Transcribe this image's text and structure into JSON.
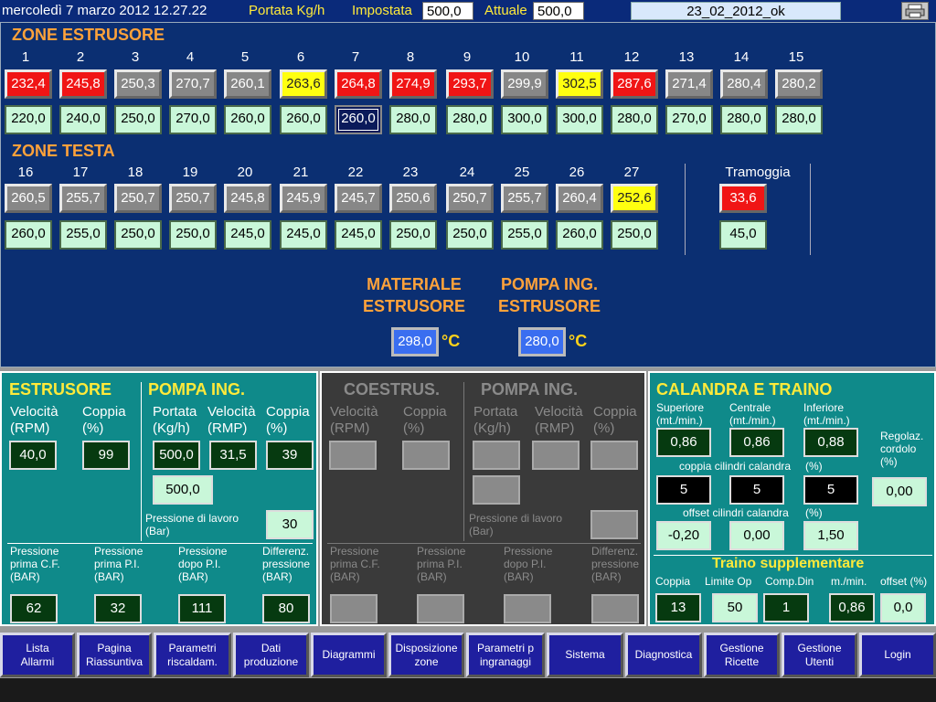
{
  "header": {
    "datetime": "mercoledì 7 marzo 2012 12.27.22",
    "portata_label": "Portata Kg/h",
    "impostata_label": "Impostata",
    "impostata_value": "500,0",
    "attuale_label": "Attuale",
    "attuale_value": "500,0",
    "recipe": "23_02_2012_ok"
  },
  "zone_estrusore": {
    "title": "ZONE ESTRUSORE",
    "numbers": [
      "1",
      "2",
      "3",
      "4",
      "5",
      "6",
      "7",
      "8",
      "9",
      "10",
      "11",
      "12",
      "13",
      "14",
      "15"
    ],
    "actual": [
      "232,4",
      "245,8",
      "250,3",
      "270,7",
      "260,1",
      "263,6",
      "264,8",
      "274,9",
      "293,7",
      "299,9",
      "302,5",
      "287,6",
      "271,4",
      "280,4",
      "280,2"
    ],
    "actual_colors": [
      "red",
      "red",
      "gray",
      "gray",
      "gray",
      "yellow",
      "red",
      "red",
      "red",
      "gray",
      "yellow",
      "red",
      "gray",
      "gray",
      "gray"
    ],
    "setpoint": [
      "220,0",
      "240,0",
      "250,0",
      "270,0",
      "260,0",
      "260,0",
      "260,0",
      "280,0",
      "280,0",
      "300,0",
      "300,0",
      "280,0",
      "270,0",
      "280,0",
      "280,0"
    ]
  },
  "zone_testa": {
    "title": "ZONE TESTA",
    "numbers": [
      "16",
      "17",
      "18",
      "19",
      "20",
      "21",
      "22",
      "23",
      "24",
      "25",
      "26",
      "27"
    ],
    "actual": [
      "260,5",
      "255,7",
      "250,7",
      "250,7",
      "245,8",
      "245,9",
      "245,7",
      "250,6",
      "250,7",
      "255,7",
      "260,4",
      "252,6"
    ],
    "actual_colors": [
      "gray",
      "gray",
      "gray",
      "gray",
      "gray",
      "gray",
      "gray",
      "gray",
      "gray",
      "gray",
      "gray",
      "yellow"
    ],
    "setpoint": [
      "260,0",
      "255,0",
      "250,0",
      "250,0",
      "245,0",
      "245,0",
      "245,0",
      "250,0",
      "250,0",
      "255,0",
      "260,0",
      "250,0"
    ]
  },
  "tramoggia": {
    "label": "Tramoggia",
    "actual": "33,6",
    "setpoint": "45,0"
  },
  "materiale": {
    "label1": "MATERIALE",
    "label2": "ESTRUSORE",
    "value": "298,0",
    "unit": "°C"
  },
  "pompa_ing_temp": {
    "label1": "POMPA ING.",
    "label2": "ESTRUSORE",
    "value": "280,0",
    "unit": "°C"
  },
  "estrusore": {
    "title": "ESTRUSORE",
    "vel_l1": "Velocità",
    "vel_l2": "(RPM)",
    "cop_l1": "Coppia",
    "cop_l2": "(%)",
    "velocita": "40,0",
    "coppia": "99"
  },
  "pompa": {
    "title": "POMPA ING.",
    "por_l1": "Portata",
    "por_l2": "(Kg/h)",
    "vel_l1": "Velocità",
    "vel_l2": "(RMP)",
    "cop_l1": "Coppia",
    "cop_l2": "(%)",
    "portata": "500,0",
    "velocita": "31,5",
    "coppia": "39",
    "portata_set": "500,0",
    "press_lavoro_l1": "Pressione di lavoro",
    "press_lavoro_l2": "(Bar)",
    "press_lavoro": "30"
  },
  "pressioni": [
    {
      "l1": "Pressione",
      "l2": "prima C.F.",
      "l3": "(BAR)",
      "v": "62"
    },
    {
      "l1": "Pressione",
      "l2": "prima P.I.",
      "l3": "(BAR)",
      "v": "32"
    },
    {
      "l1": "Pressione",
      "l2": "dopo P.I.",
      "l3": "(BAR)",
      "v": "111"
    },
    {
      "l1": "Differenz.",
      "l2": "pressione",
      "l3": "(BAR)",
      "v": "80"
    }
  ],
  "coestrus": {
    "title": "COESTRUS.",
    "pompa_title": "POMPA ING.",
    "vel_l1": "Velocità",
    "vel_l2": "(RPM)",
    "cop_l1": "Coppia",
    "cop_l2": "(%)",
    "por_l1": "Portata",
    "por_l2": "(Kg/h)",
    "pvel_l1": "Velocità",
    "pvel_l2": "(RMP)",
    "pcop_l1": "Coppia",
    "pcop_l2": "(%)",
    "press_lavoro_l1": "Pressione di lavoro",
    "press_lavoro_l2": "(Bar)",
    "pressioni": [
      {
        "l1": "Pressione",
        "l2": "prima C.F.",
        "l3": "(BAR)"
      },
      {
        "l1": "Pressione",
        "l2": "prima P.I.",
        "l3": "(BAR)"
      },
      {
        "l1": "Pressione",
        "l2": "dopo P.I.",
        "l3": "(BAR)"
      },
      {
        "l1": "Differenz.",
        "l2": "pressione",
        "l3": "(BAR)"
      }
    ]
  },
  "calandra": {
    "title": "CALANDRA E TRAINO",
    "sup_l1": "Superiore",
    "sup_l2": "(mt./min.)",
    "cen_l1": "Centrale",
    "cen_l2": "(mt./min.)",
    "inf_l1": "Inferiore",
    "inf_l2": "(mt./min.)",
    "superiore": "0,86",
    "centrale": "0,86",
    "inferiore": "0,88",
    "regolaz_l1": "Regolaz.",
    "regolaz_l2": "cordolo",
    "regolaz_l3": "(%)",
    "regolaz": "0,00",
    "coppia_label": "coppia cilindri calandra",
    "coppia_pct": "(%)",
    "coppia_vals": [
      "5",
      "5",
      "5"
    ],
    "offset_label": "offset cilindri calandra",
    "offset_pct": "(%)",
    "offset_vals": [
      "-0,20",
      "0,00",
      "1,50"
    ],
    "traino_title": "Traino supplementare",
    "coppia_l": "Coppia",
    "limite_l": "Limite Op",
    "compdin_l": "Comp.Din",
    "mmin_l": "m./min.",
    "offset_l": "offset (%)",
    "coppia": "13",
    "limite": "50",
    "compdin": "1",
    "mmin": "0,86",
    "offset": "0,0"
  },
  "nav": [
    {
      "l1": "Lista",
      "l2": "Allarmi"
    },
    {
      "l1": "Pagina",
      "l2": "Riassuntiva"
    },
    {
      "l1": "Parametri",
      "l2": "riscaldam."
    },
    {
      "l1": "Dati",
      "l2": "produzione"
    },
    {
      "l1": "Diagrammi",
      "l2": ""
    },
    {
      "l1": "Disposizione",
      "l2": "zone"
    },
    {
      "l1": "Parametri  p",
      "l2": "ingranaggi"
    },
    {
      "l1": "Sistema",
      "l2": ""
    },
    {
      "l1": "Diagnostica",
      "l2": ""
    },
    {
      "l1": "Gestione",
      "l2": "Ricette"
    },
    {
      "l1": "Gestione",
      "l2": "Utenti"
    },
    {
      "l1": "Login",
      "l2": ""
    }
  ],
  "colors": {
    "red": "#f01515",
    "yellow": "#ffff10",
    "gray": "#878787",
    "setpoint_green": "#c9f7d9",
    "zone_bg": "#0b2f72",
    "panel_teal": "#0f8a8a",
    "panel_dark": "#3a3a3a",
    "nav_blue": "#1f1f9f"
  },
  "icons": {
    "printer": "printer-icon"
  }
}
